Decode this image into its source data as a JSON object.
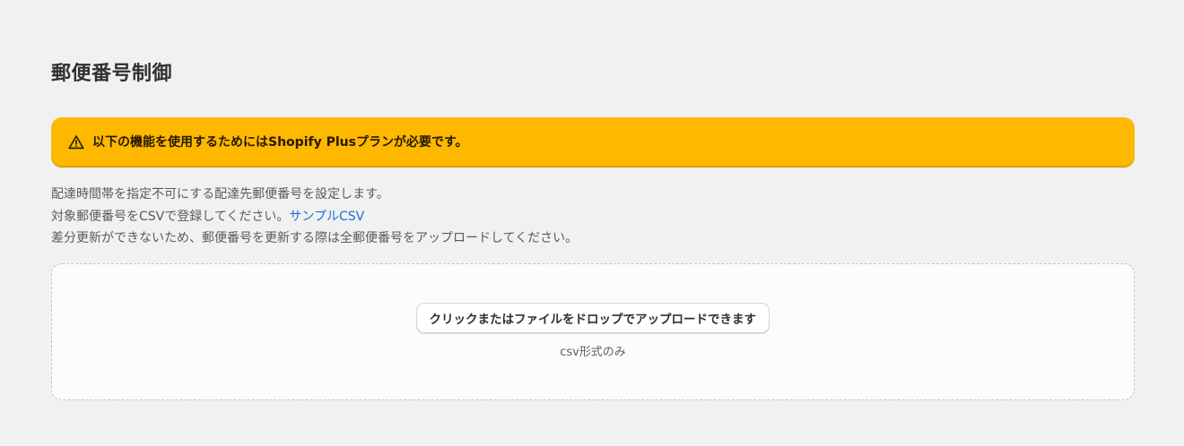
{
  "page": {
    "title": "郵便番号制御"
  },
  "banner": {
    "icon": "warning-triangle-icon",
    "text": "以下の機能を使用するためにはShopify Plusプランが必要です。",
    "color": "#ffb800"
  },
  "description": {
    "line1": "配達時間帯を指定不可にする配達先郵便番号を設定します。",
    "line2_prefix": "対象郵便番号をCSVで登録してください。",
    "sample_link": "サンプルCSV",
    "line3": "差分更新ができないため、郵便番号を更新する際は全郵便番号をアップロードしてください。"
  },
  "upload": {
    "button_label": "クリックまたはファイルをドロップでアップロードできます",
    "hint": "csv形式のみ"
  },
  "colors": {
    "link": "#1d6fd6",
    "background": "#f1f1f1"
  }
}
